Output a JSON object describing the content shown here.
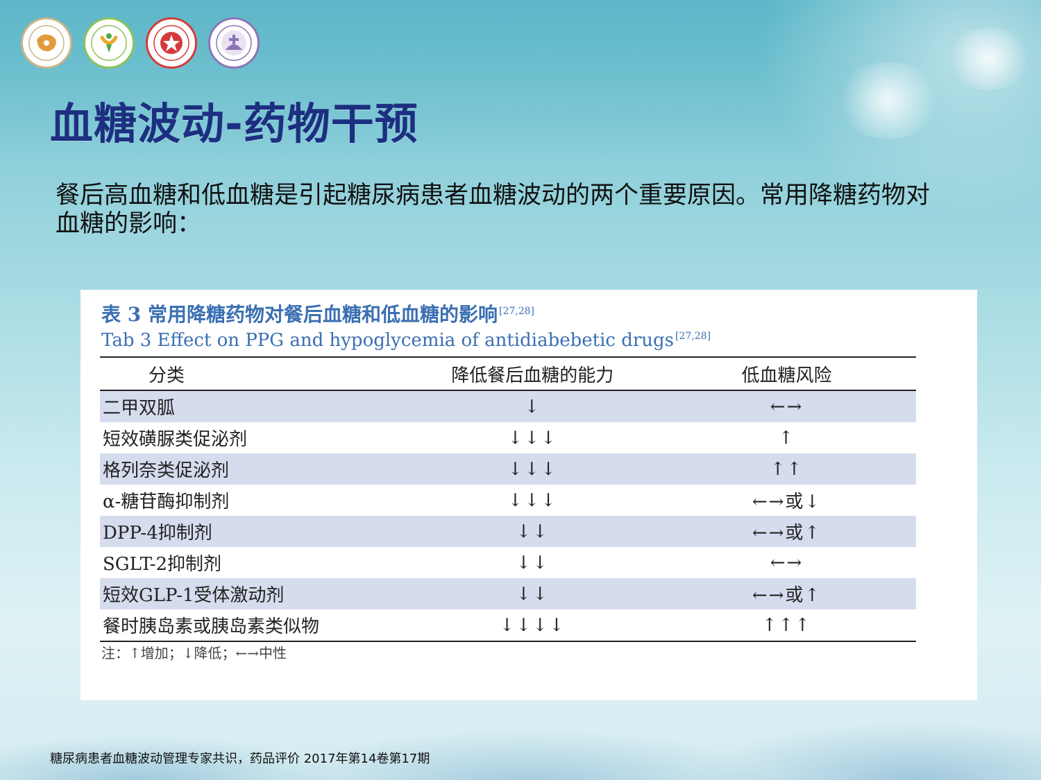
{
  "title": "血糖波动-药物干预",
  "intro": "餐后高血糖和低血糖是引起糖尿病患者血糖波动的两个重要原因。常用降糖药物对血糖的影响：",
  "table": {
    "caption_cn": "表 3 常用降糖药物对餐后血糖和低血糖的影响",
    "caption_cn_ref": "[27,28]",
    "caption_en": "Tab 3 Effect on PPG and hypoglycemia of antidiabebetic drugs",
    "caption_en_ref": "[27,28]",
    "headers": [
      "分类",
      "降低餐后血糖的能力",
      "低血糖风险"
    ],
    "rows": [
      {
        "category": "二甲双胍",
        "ppg": "↓",
        "hypo": "←→"
      },
      {
        "category": "短效磺脲类促泌剂",
        "ppg": "↓↓↓",
        "hypo": "↑"
      },
      {
        "category": "格列奈类促泌剂",
        "ppg": "↓↓↓",
        "hypo": "↑↑"
      },
      {
        "category": "α-糖苷酶抑制剂",
        "ppg": "↓↓↓",
        "hypo": "←→或↓"
      },
      {
        "category": "DPP-4抑制剂",
        "ppg": "↓↓",
        "hypo": "←→或↑"
      },
      {
        "category": "SGLT-2抑制剂",
        "ppg": "↓↓",
        "hypo": "←→"
      },
      {
        "category": "短效GLP-1受体激动剂",
        "ppg": "↓↓",
        "hypo": "←→或↑"
      },
      {
        "category": "餐时胰岛素或胰岛素类似物",
        "ppg": "↓↓↓↓",
        "hypo": "↑↑↑"
      }
    ],
    "note": "注：↑增加；↓降低；←→中性"
  },
  "source": "糖尿病患者血糖波动管理专家共识，药品评价 2017年第14卷第17期",
  "logos": [
    {
      "icon": "chinese-medical-association-logo"
    },
    {
      "icon": "chinese-society-of-geriatrics-logo"
    },
    {
      "icon": "health-promotion-foundation-logo"
    },
    {
      "icon": "nursing-association-logo"
    }
  ],
  "colors": {
    "title": "#1d2f80",
    "caption": "#3a6fb2",
    "row_shade": "#d5dced"
  }
}
